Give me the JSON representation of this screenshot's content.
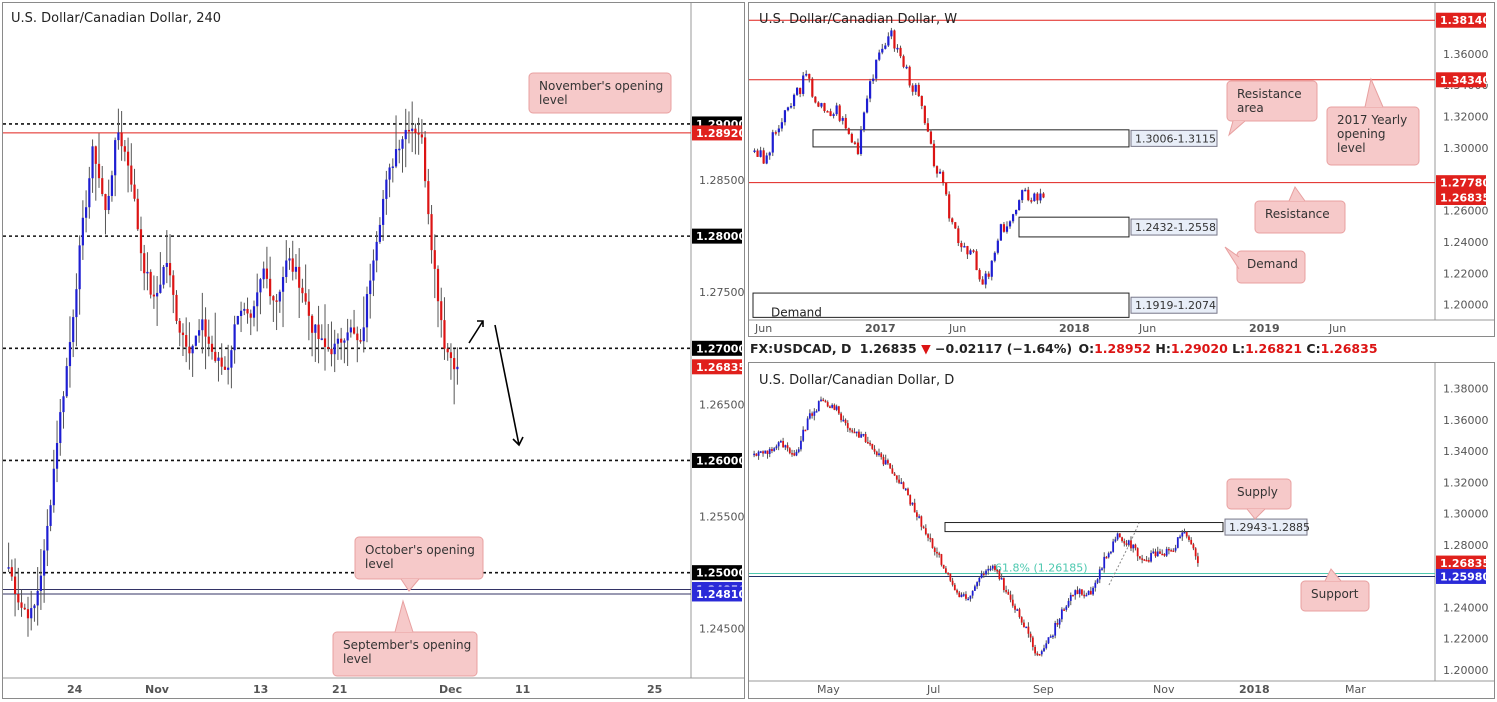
{
  "charts": {
    "h4": {
      "title": "U.S. Dollar/Canadian Dollar, 240",
      "ymin": 1.2415,
      "ymax": 1.299,
      "ticks": [
        "1.28500",
        "1.27500",
        "1.26500",
        "1.25500",
        "1.24500"
      ],
      "xlabels": [
        "24",
        "Nov",
        "13",
        "21",
        "Dec",
        "11",
        "25"
      ],
      "levels": [
        {
          "price": 1.29,
          "label": "1.29000",
          "kind": "dotted",
          "bg": "#000000"
        },
        {
          "price": 1.2892,
          "label": "1.28920",
          "kind": "red",
          "bg": "#e0201c"
        },
        {
          "price": 1.28,
          "label": "1.28000",
          "kind": "dotted",
          "bg": "#000000"
        },
        {
          "price": 1.27,
          "label": "1.27000",
          "kind": "dotted",
          "bg": "#000000"
        },
        {
          "price": 1.26835,
          "label": "1.26835",
          "kind": "none",
          "bg": "#e0201c"
        },
        {
          "price": 1.26,
          "label": "1.26000",
          "kind": "dotted",
          "bg": "#000000"
        },
        {
          "price": 1.25,
          "label": "1.25000",
          "kind": "dotted",
          "bg": "#000000"
        },
        {
          "price": 1.2485,
          "label": "1.24850",
          "kind": "navy",
          "bg": "#2a2ad8"
        },
        {
          "price": 1.2481,
          "label": "1.24810",
          "kind": "navy",
          "bg": "#2a2ad8"
        }
      ],
      "notes": [
        {
          "text": [
            "November's opening",
            "level"
          ]
        },
        {
          "text": [
            "October's opening",
            "level"
          ]
        },
        {
          "text": [
            "September's opening",
            "level"
          ]
        }
      ]
    },
    "weekly": {
      "title": "U.S. Dollar/Canadian Dollar, W",
      "ymin": 1.1915,
      "ymax": 1.386,
      "ticks": [
        "1.36000",
        "1.34000",
        "1.32000",
        "1.30000",
        "1.26000",
        "1.24000",
        "1.22000",
        "1.20000"
      ],
      "xlabels": [
        "Jun",
        "2017",
        "Jun",
        "2018",
        "Jun",
        "2019",
        "Jun"
      ],
      "levels": [
        {
          "price": 1.3814,
          "label": "1.38140",
          "bg": "#e0201c"
        },
        {
          "price": 1.3434,
          "label": "1.34340",
          "bg": "#e0201c"
        },
        {
          "price": 1.2778,
          "label": "1.27780",
          "bg": "#e0201c"
        },
        {
          "price": 1.26835,
          "label": "1.26835",
          "bg": "#e0201c"
        }
      ],
      "boxes": [
        {
          "label": "1.3006-1.3115",
          "low": 1.3006,
          "high": 1.3115
        },
        {
          "label": "1.2432-1.2558",
          "low": 1.2432,
          "high": 1.2558
        },
        {
          "label": "1.1919-1.2074",
          "low": 1.1919,
          "high": 1.2074
        }
      ],
      "demand_text": "Demand",
      "notes": [
        {
          "text": [
            "Resistance",
            "area"
          ]
        },
        {
          "text": [
            "2017 Yearly",
            "opening",
            "level"
          ]
        },
        {
          "text": [
            "Resistance"
          ]
        },
        {
          "text": [
            "Demand"
          ]
        }
      ]
    },
    "daily": {
      "title": "U.S. Dollar/Canadian Dollar, D",
      "ymin": 1.198,
      "ymax": 1.39,
      "ticks": [
        "1.38000",
        "1.36000",
        "1.34000",
        "1.32000",
        "1.30000",
        "1.28000",
        "1.24000",
        "1.22000",
        "1.20000"
      ],
      "xlabels": [
        "May",
        "Jul",
        "Sep",
        "Nov",
        "2018",
        "Mar"
      ],
      "levels": [
        {
          "price": 1.26835,
          "label": "1.26835",
          "bg": "#e0201c"
        },
        {
          "price": 1.2598,
          "label": "1.25980",
          "bg": "#2a2ad8"
        }
      ],
      "supply_box": {
        "label": "1.2943-1.2885",
        "low": 1.2885,
        "high": 1.2943
      },
      "fib_text": "61.8% (1.26185)",
      "notes": [
        {
          "text": [
            "Supply"
          ]
        },
        {
          "text": [
            "Support"
          ]
        }
      ]
    }
  },
  "infobar": {
    "symbol": "FX:USDCAD, D",
    "price": "1.26835",
    "arrow": "▼",
    "change": "−0.02117 (−1.64%)",
    "o_label": "O:",
    "o": "1.28952",
    "h_label": "H:",
    "h": "1.29020",
    "l_label": "L:",
    "l": "1.26821",
    "c_label": "C:",
    "c": "1.26835"
  },
  "colors": {
    "up": "#1e1ed2",
    "down": "#dc1414",
    "note_bg": "#f6c9c9",
    "note_border": "#e8a0a0",
    "fib": "#4ec9b0"
  }
}
